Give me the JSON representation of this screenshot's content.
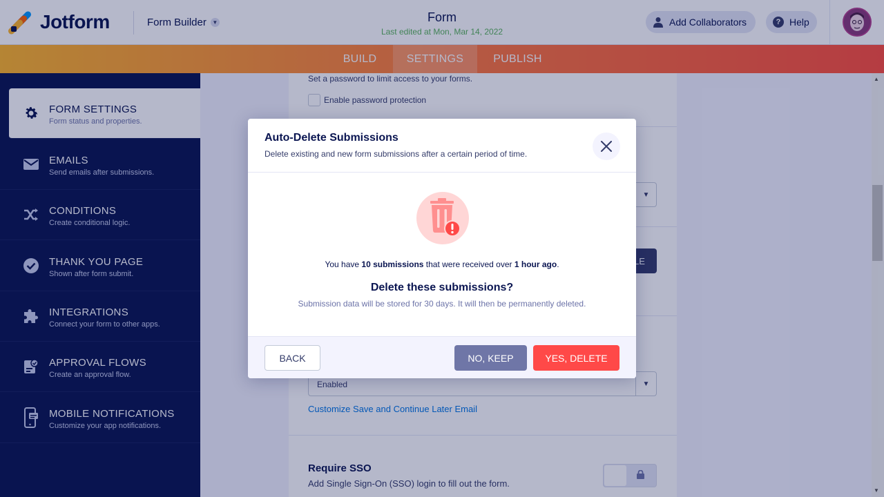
{
  "header": {
    "logo_text": "Jotform",
    "builder_label": "Form Builder",
    "form_title": "Form",
    "last_edited": "Last edited at Mon, Mar 14, 2022",
    "collaborators_label": "Add Collaborators",
    "help_label": "Help"
  },
  "nav": {
    "tabs": [
      {
        "label": "BUILD"
      },
      {
        "label": "SETTINGS"
      },
      {
        "label": "PUBLISH"
      }
    ],
    "active_tab": "SETTINGS"
  },
  "sidebar": {
    "items": [
      {
        "title": "FORM SETTINGS",
        "subtitle": "Form status and properties.",
        "icon": "gear-icon"
      },
      {
        "title": "EMAILS",
        "subtitle": "Send emails after submissions.",
        "icon": "envelope-icon"
      },
      {
        "title": "CONDITIONS",
        "subtitle": "Create conditional logic.",
        "icon": "shuffle-icon"
      },
      {
        "title": "THANK YOU PAGE",
        "subtitle": "Shown after form submit.",
        "icon": "check-circle-icon"
      },
      {
        "title": "INTEGRATIONS",
        "subtitle": "Connect your form to other apps.",
        "icon": "puzzle-icon"
      },
      {
        "title": "APPROVAL FLOWS",
        "subtitle": "Create an approval flow.",
        "icon": "approval-icon"
      },
      {
        "title": "MOBILE NOTIFICATIONS",
        "subtitle": "Customize your app notifications.",
        "icon": "mobile-icon"
      }
    ]
  },
  "background": {
    "password_desc": "Set a password to limit access to your forms.",
    "password_checkbox": "Enable password protection",
    "dark_button_partial": "LE",
    "select_value": "Enabled",
    "customize_link": "Customize Save and Continue Later Email",
    "sso_title": "Require SSO",
    "sso_sub": "Add Single Sign-On (SSO) login to fill out the form."
  },
  "modal": {
    "title": "Auto-Delete Submissions",
    "subtitle": "Delete existing and new form submissions after a certain period of time.",
    "info_prefix": "You have ",
    "info_count": "10 submissions",
    "info_middle": " that were received over ",
    "info_time": "1 hour ago",
    "info_suffix": ".",
    "question": "Delete these submissions?",
    "note": "Submission data will be stored for 30 days. It will then be permanently deleted.",
    "back_label": "BACK",
    "keep_label": "NO, KEEP",
    "delete_label": "YES, DELETE"
  },
  "colors": {
    "navy": "#0a1551",
    "danger": "#ff4948",
    "keep": "#6f76a7"
  }
}
